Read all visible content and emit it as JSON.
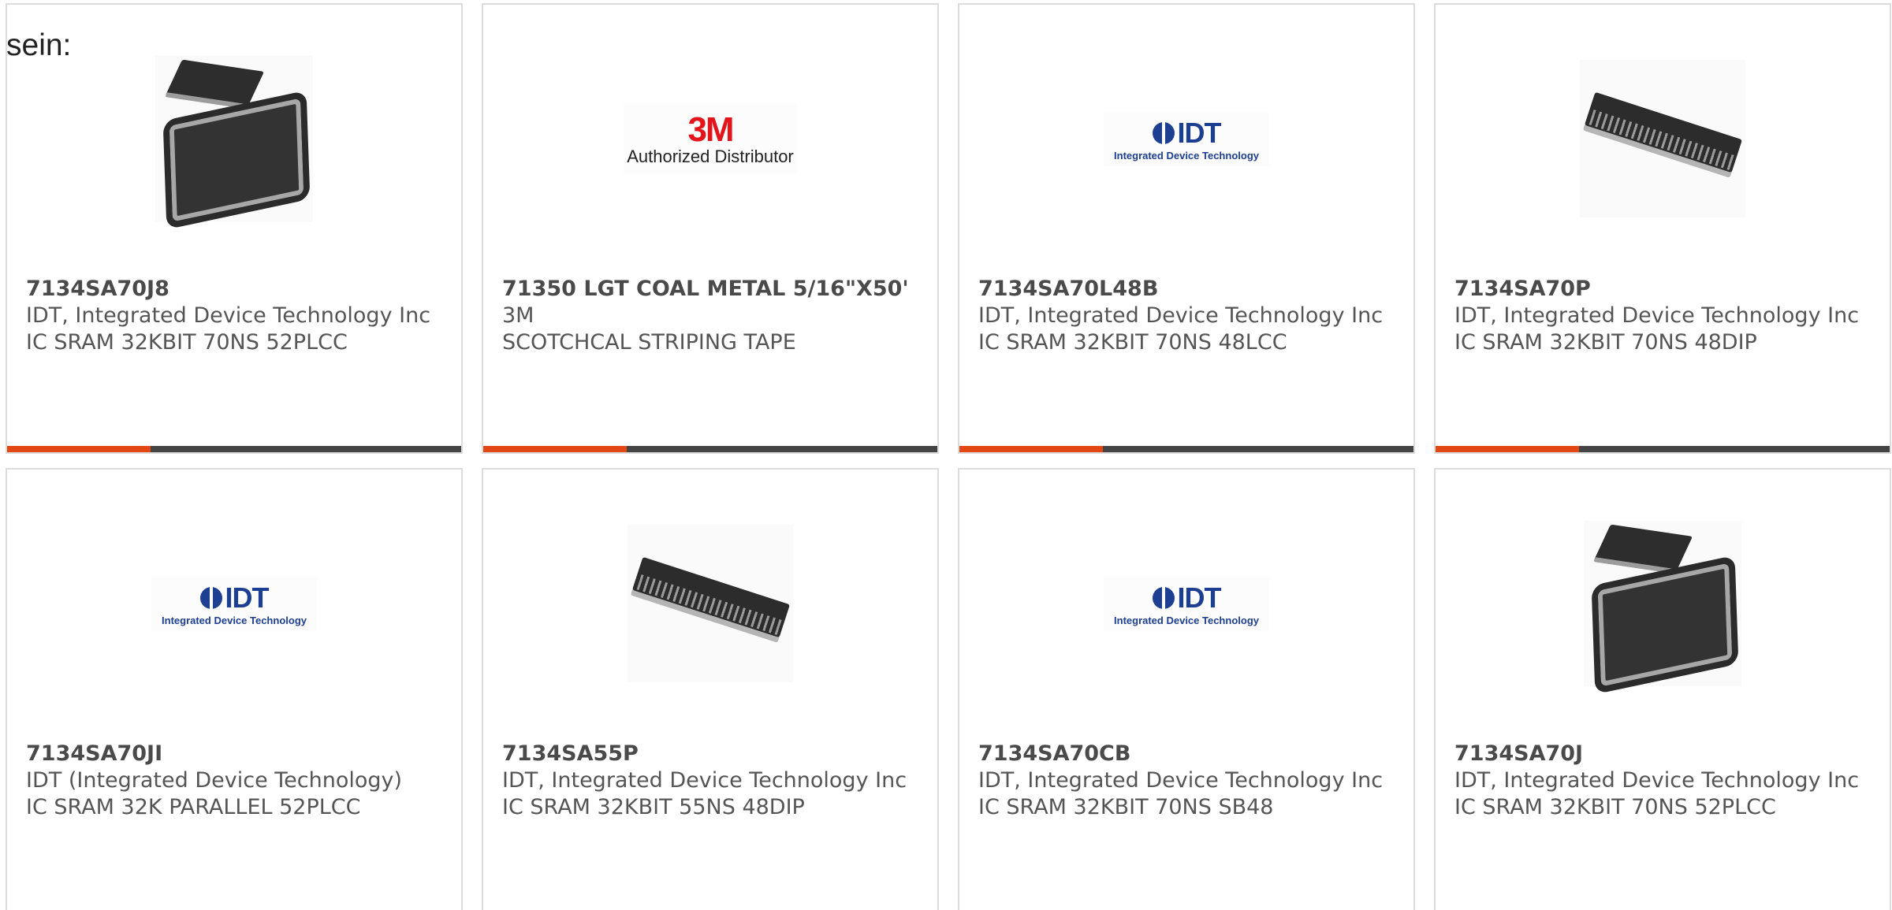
{
  "intro": "sein:",
  "products": [
    {
      "part": "7134SA70J8",
      "manufacturer": "IDT, Integrated Device Technology Inc",
      "description": "IC SRAM 32KBIT 70NS 52PLCC",
      "image": "plcc-chip-photo"
    },
    {
      "part": "71350 LGT COAL METAL 5/16\"X50'",
      "manufacturer": "3M",
      "description": "SCOTCHCAL STRIPING TAPE",
      "image": "3m-authorized-distributor-logo",
      "logo_mark": "3M",
      "logo_sub": "Authorized Distributor"
    },
    {
      "part": "7134SA70L48B",
      "manufacturer": "IDT, Integrated Device Technology Inc",
      "description": "IC SRAM 32KBIT 70NS 48LCC",
      "image": "idt-logo",
      "logo_word": "IDT",
      "logo_sub": "Integrated Device Technology"
    },
    {
      "part": "7134SA70P",
      "manufacturer": "IDT, Integrated Device Technology Inc",
      "description": "IC SRAM 32KBIT 70NS 48DIP",
      "image": "dip-chip-photo"
    },
    {
      "part": "7134SA70JI",
      "manufacturer": "IDT (Integrated Device Technology)",
      "description": "IC SRAM 32K PARALLEL 52PLCC",
      "image": "idt-logo",
      "logo_word": "IDT",
      "logo_sub": "Integrated Device Technology"
    },
    {
      "part": "7134SA55P",
      "manufacturer": "IDT, Integrated Device Technology Inc",
      "description": "IC SRAM 32KBIT 55NS 48DIP",
      "image": "dip-chip-photo"
    },
    {
      "part": "7134SA70CB",
      "manufacturer": "IDT, Integrated Device Technology Inc",
      "description": "IC SRAM 32KBIT 70NS SB48",
      "image": "idt-logo",
      "logo_word": "IDT",
      "logo_sub": "Integrated Device Technology"
    },
    {
      "part": "7134SA70J",
      "manufacturer": "IDT, Integrated Device Technology Inc",
      "description": "IC SRAM 32KBIT 70NS 52PLCC",
      "image": "plcc-chip-photo"
    }
  ],
  "colors": {
    "accent": "#e34713",
    "bar": "#444444",
    "logo_3m": "#e4141b",
    "logo_idt": "#1d3f91"
  }
}
